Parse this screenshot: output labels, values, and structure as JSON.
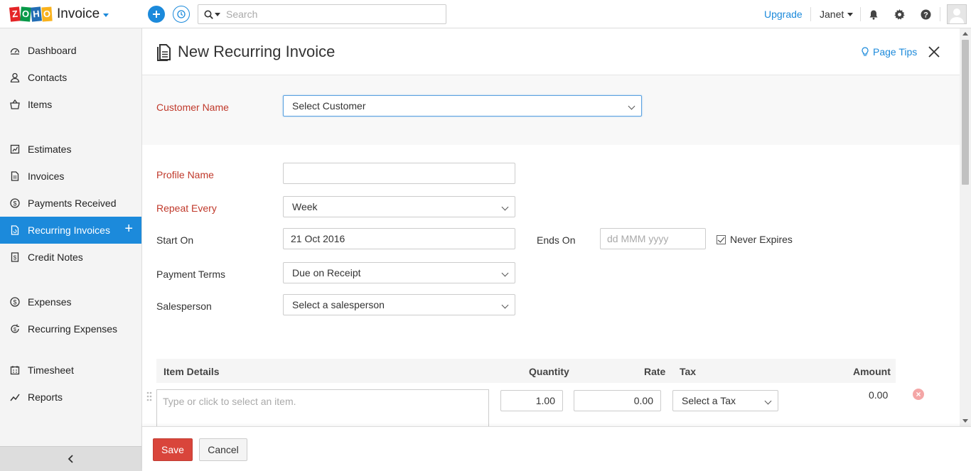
{
  "app": {
    "logo_letters": [
      "Z",
      "O",
      "H",
      "O"
    ],
    "name": "Invoice"
  },
  "header": {
    "search_placeholder": "Search",
    "upgrade": "Upgrade",
    "user": "Janet"
  },
  "sidebar": {
    "items": [
      {
        "label": "Dashboard",
        "icon": "dashboard-icon"
      },
      {
        "label": "Contacts",
        "icon": "contacts-icon"
      },
      {
        "label": "Items",
        "icon": "items-icon"
      },
      {
        "label": "Estimates",
        "icon": "estimates-icon"
      },
      {
        "label": "Invoices",
        "icon": "invoices-icon"
      },
      {
        "label": "Payments Received",
        "icon": "payments-icon"
      },
      {
        "label": "Recurring Invoices",
        "icon": "recurring-invoices-icon",
        "active": true
      },
      {
        "label": "Credit Notes",
        "icon": "credit-notes-icon"
      },
      {
        "label": "Expenses",
        "icon": "expenses-icon"
      },
      {
        "label": "Recurring Expenses",
        "icon": "recurring-expenses-icon"
      },
      {
        "label": "Timesheet",
        "icon": "timesheet-icon"
      },
      {
        "label": "Reports",
        "icon": "reports-icon"
      }
    ]
  },
  "page": {
    "title": "New Recurring Invoice",
    "page_tips": "Page Tips"
  },
  "form": {
    "customer_name_label": "Customer Name",
    "customer_placeholder": "Select Customer",
    "profile_name_label": "Profile Name",
    "profile_name_value": "",
    "repeat_every_label": "Repeat Every",
    "repeat_every_value": "Week",
    "start_on_label": "Start On",
    "start_on_value": "21 Oct 2016",
    "ends_on_label": "Ends On",
    "ends_on_placeholder": "dd MMM yyyy",
    "never_expires_label": "Never Expires",
    "never_expires_checked": true,
    "payment_terms_label": "Payment Terms",
    "payment_terms_value": "Due on Receipt",
    "salesperson_label": "Salesperson",
    "salesperson_placeholder": "Select a salesperson"
  },
  "items_table": {
    "headers": {
      "item_details": "Item Details",
      "quantity": "Quantity",
      "rate": "Rate",
      "tax": "Tax",
      "amount": "Amount"
    },
    "row": {
      "item_placeholder": "Type or click to select an item.",
      "quantity": "1.00",
      "rate": "0.00",
      "tax_placeholder": "Select a Tax",
      "amount": "0.00"
    }
  },
  "footer": {
    "save": "Save",
    "cancel": "Cancel"
  },
  "colors": {
    "accent": "#1c8adb",
    "required": "#c0392b",
    "save": "#d9453b"
  }
}
